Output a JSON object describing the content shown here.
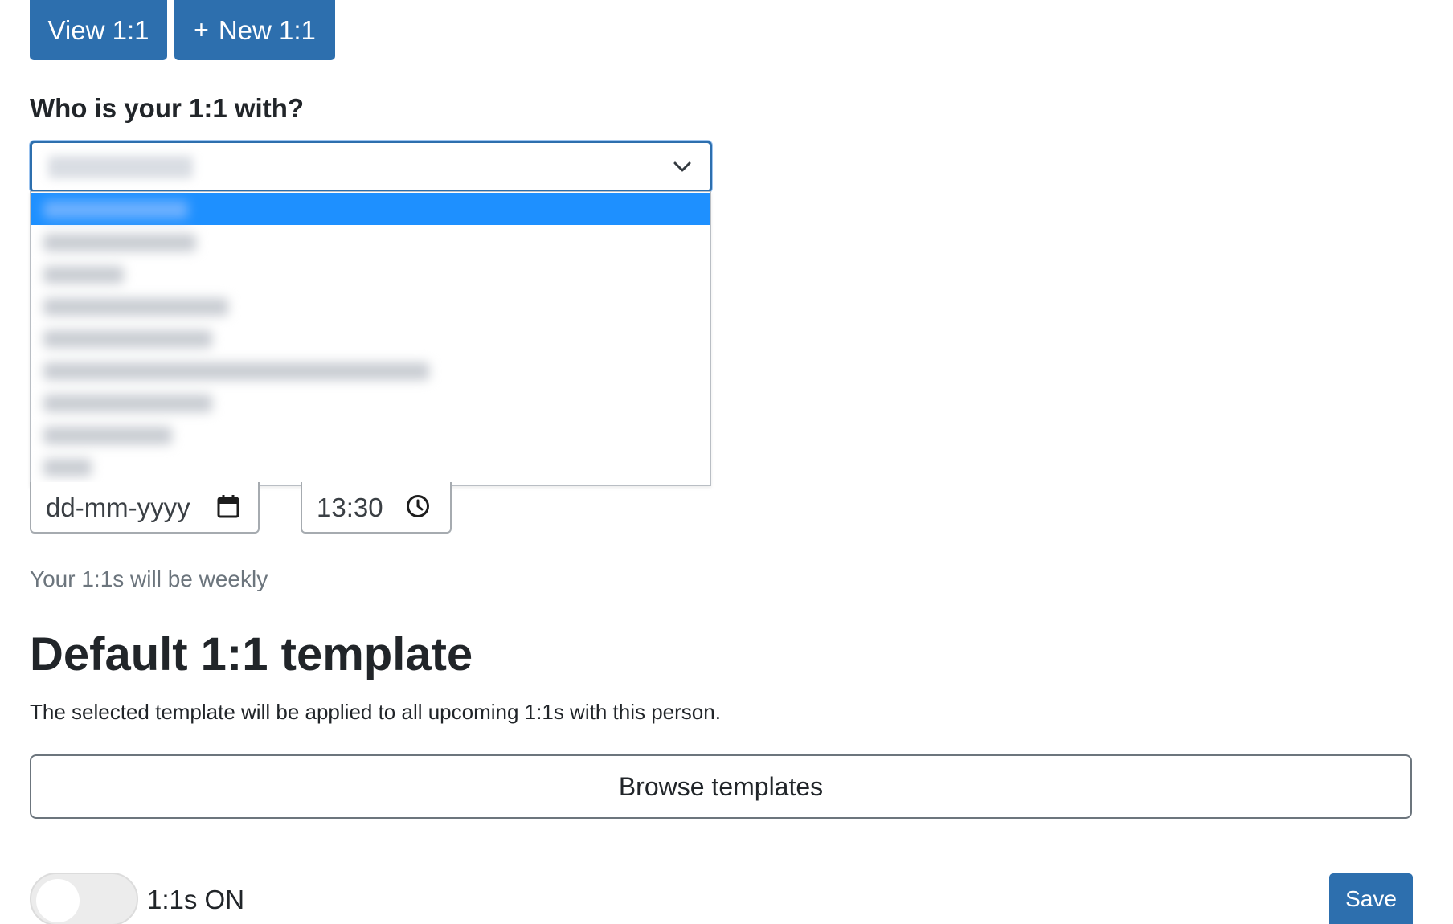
{
  "top_buttons": {
    "view_label": "View 1:1",
    "new_plus": "+",
    "new_label": "New 1:1"
  },
  "form": {
    "question": "Who is your 1:1 with?",
    "date_placeholder": "dd-mm-yyyy",
    "time_value": "13:30",
    "frequency_text": "Your 1:1s will be weekly"
  },
  "template": {
    "heading": "Default 1:1 template",
    "description": "The selected template will be applied to all upcoming 1:1s with this person.",
    "browse_label": "Browse templates"
  },
  "footer": {
    "toggle_label": "1:1s ON",
    "save_label": "Save"
  },
  "colors": {
    "primary": "#2d6fae",
    "option_highlight": "#1e90ff",
    "muted_text": "#6c757d"
  },
  "icons": [
    "chevron-down-icon",
    "calendar-icon",
    "clock-icon"
  ]
}
